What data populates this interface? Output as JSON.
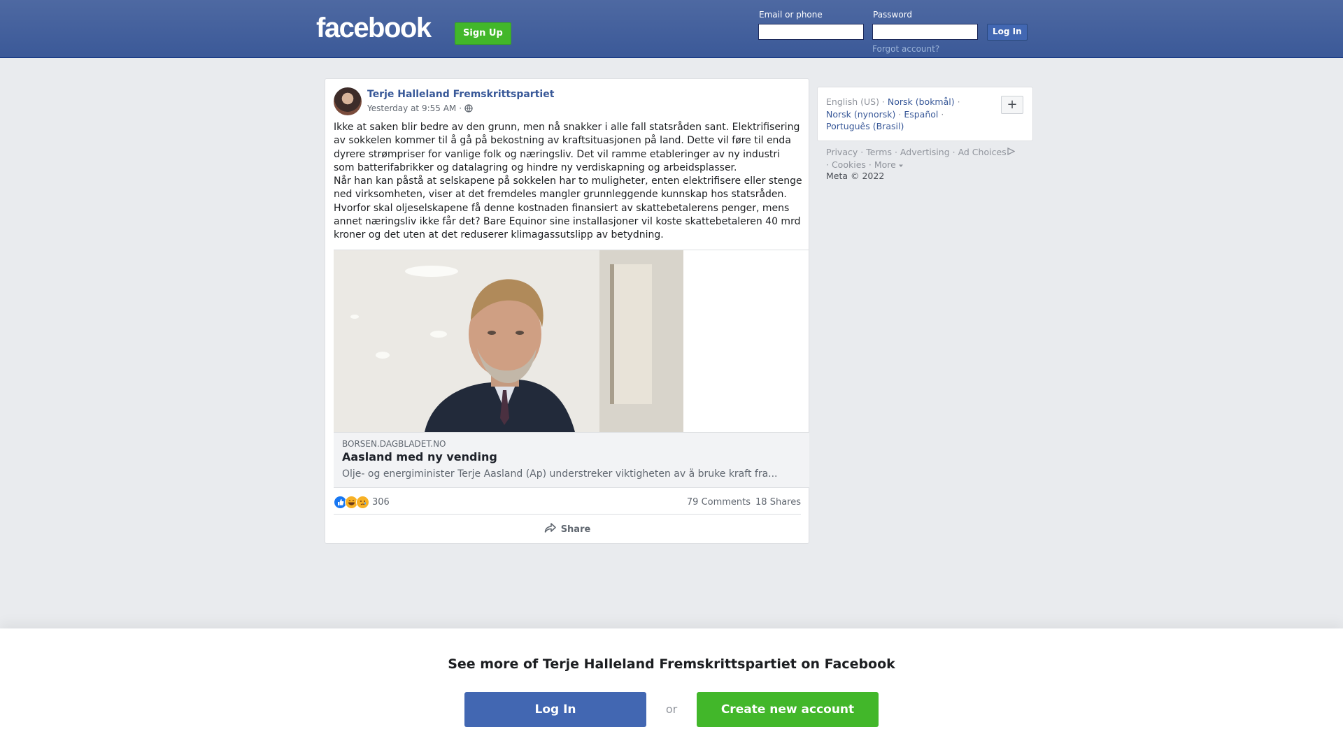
{
  "header": {
    "logo": "facebook",
    "signup_label": "Sign Up",
    "email_label": "Email or phone",
    "email_value": "",
    "password_label": "Password",
    "password_value": "",
    "login_label": "Log In",
    "forgot_label": "Forgot account?"
  },
  "post": {
    "author": "Terje Halleland Fremskrittspartiet",
    "timestamp": "Yesterday at 9:55 AM",
    "timestamp_sep": "·",
    "privacy_icon": "globe-icon",
    "text": "Ikke at saken blir bedre av den grunn, men nå snakker i alle fall statsråden sant. Elektrifisering av sokkelen kommer til å gå på bekostning av kraftsituasjonen på land. Dette vil føre til enda dyrere strømpriser for vanlige folk og næringsliv. Det vil ramme etableringer av ny industri som batterifabrikker og datalagring og hindre ny verdiskapning og arbeidsplasser.\nNår han kan påstå at selskapene på sokkelen har to muligheter, enten elektrifisere eller stenge ned virksomheten, viser at det fremdeles mangler grunnleggende kunnskap hos statsråden. Hvorfor skal oljeselskapene få denne kostnaden finansiert av skattebetalerens penger, mens annet næringsliv ikke får det? Bare Equinor sine installasjoner vil koste skattebetaleren 40 mrd kroner og det uten at det reduserer klimagassutslipp av betydning.",
    "link": {
      "domain": "BORSEN.DAGBLADET.NO",
      "title": "Aasland med ny vending",
      "description": "Olje- og energiminister Terje Aasland (Ap) understreker viktigheten av å bruke kraft fra..."
    },
    "reactions": {
      "icons": [
        "like-icon",
        "haha-icon",
        "sad-icon"
      ],
      "count": "306"
    },
    "comments": "79 Comments",
    "shares": "18 Shares",
    "share_label": "Share"
  },
  "sidebar": {
    "languages": [
      {
        "label": "English (US)",
        "link": false
      },
      {
        "label": "Norsk (bokmål)",
        "link": true
      },
      {
        "label": "Norsk (nynorsk)",
        "link": true
      },
      {
        "label": "Español",
        "link": true
      },
      {
        "label": "Português (Brasil)",
        "link": true
      }
    ],
    "lang_more": "+",
    "footer": [
      "Privacy",
      "Terms",
      "Advertising",
      "Ad Choices",
      "Cookies",
      "More"
    ],
    "copyright": "Meta © 2022"
  },
  "banner": {
    "title": "See more of Terje Halleland Fremskrittspartiet on Facebook",
    "login_label": "Log In",
    "or_label": "or",
    "create_label": "Create new account"
  },
  "colors": {
    "brand": "#3b5998",
    "button_blue": "#4267b2",
    "button_green": "#42b72a",
    "link": "#385898"
  }
}
